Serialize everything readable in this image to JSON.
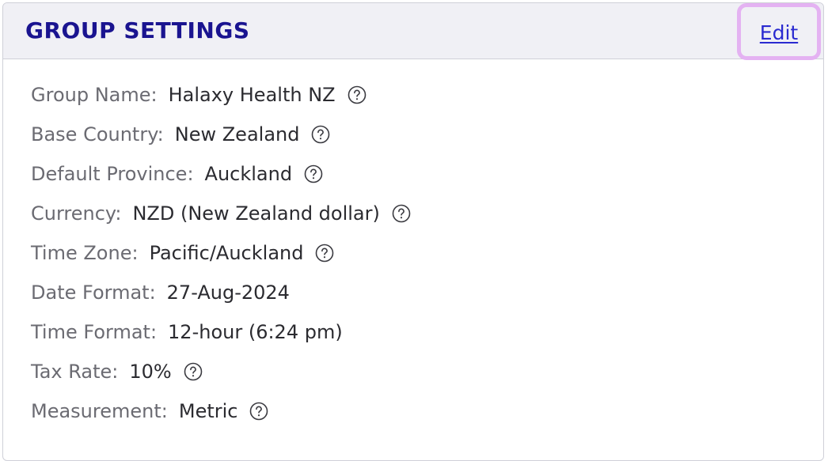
{
  "header": {
    "title": "GROUP SETTINGS",
    "edit_label": "Edit"
  },
  "fields": [
    {
      "label": "Group Name:",
      "value": "Halaxy Health NZ",
      "help": true
    },
    {
      "label": "Base Country:",
      "value": "New Zealand",
      "help": true
    },
    {
      "label": "Default Province:",
      "value": "Auckland",
      "help": true
    },
    {
      "label": "Currency:",
      "value": "NZD (New Zealand dollar)",
      "help": true
    },
    {
      "label": "Time Zone:",
      "value": "Pacific/Auckland",
      "help": true
    },
    {
      "label": "Date Format:",
      "value": "27-Aug-2024",
      "help": false
    },
    {
      "label": "Time Format:",
      "value": "12-hour (6:24 pm)",
      "help": false
    },
    {
      "label": "Tax Rate:",
      "value": "10%",
      "help": true
    },
    {
      "label": "Measurement:",
      "value": "Metric",
      "help": true
    }
  ],
  "icons": {
    "help": "question-circle-icon"
  },
  "colors": {
    "title": "#1a1490",
    "link": "#2a2ad0",
    "highlight": "#e4b2f2",
    "header_bg": "#f0f0f5",
    "label": "#6b6b72",
    "value": "#2b2b30"
  }
}
